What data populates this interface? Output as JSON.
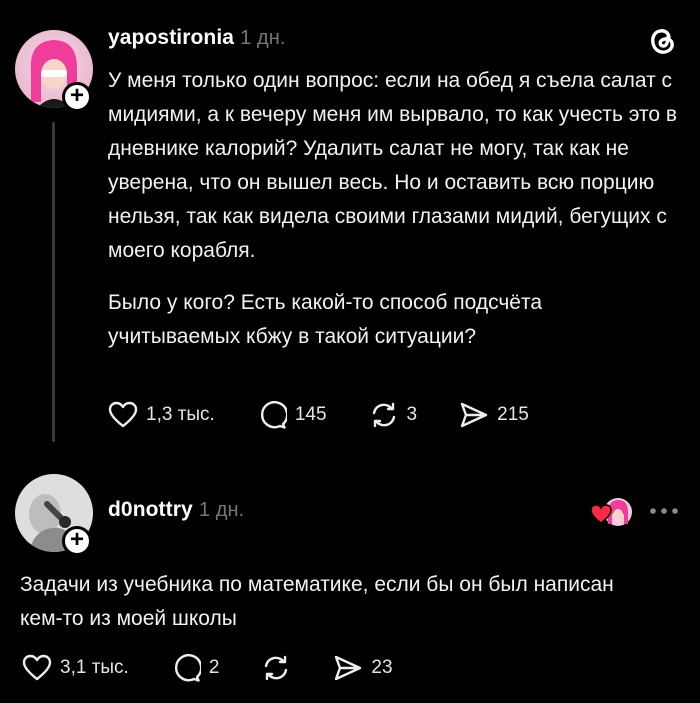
{
  "post": {
    "username": "yapostironia",
    "time": "1 дн.",
    "paragraph1": "У меня только один вопрос: если на обед я съела салат с мидиями, а к вечеру меня им вырвало, то как учесть это в дневнике калорий? Удалить салат не могу, так как не уверена, что он вышел весь. Но и оставить всю порцию нельзя, так как видела своими глазами мидий, бегущих с моего корабля.",
    "paragraph2": "Было у кого? Есть какой-то способ подсчёта учитываемых кбжу в такой ситуации?",
    "likes": "1,3 тыс.",
    "comments": "145",
    "reposts": "3",
    "shares": "215"
  },
  "reply": {
    "username": "d0nottry",
    "time": "1 дн.",
    "text": "Задачи из учебника по математике, если бы он был написан кем-то из моей школы",
    "likes": "3,1 тыс.",
    "comments": "2",
    "reposts": "",
    "shares": "23"
  },
  "icons": {
    "threads_logo": "threads-logo-icon",
    "more": "more-dots-icon",
    "like": "heart-icon",
    "comment": "comment-bubble-icon",
    "repost": "repost-icon",
    "share": "send-icon"
  }
}
